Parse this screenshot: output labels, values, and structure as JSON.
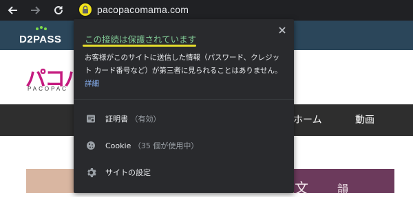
{
  "browser": {
    "url": "pacopacomama.com",
    "back_icon": "back-arrow-icon",
    "forward_icon": "forward-arrow-icon",
    "reload_icon": "reload-icon",
    "lock_icon": "lock-icon"
  },
  "site": {
    "d2pass_logo": "D2PASS",
    "paco_logo": "パコパ",
    "paco_sub": "PACOPAC",
    "nav_home": "ホーム",
    "nav_video": "動画",
    "banner_text1": "文",
    "banner_text2": "韻"
  },
  "popup": {
    "title": "この接続は保護されています",
    "description": "お客様がこのサイトに送信した情報（パスワード、クレジット カード番号など）が第三者に見られることはありません。",
    "details_link": "詳細",
    "close_icon": "close-icon",
    "rows": [
      {
        "icon": "certificate-icon",
        "label": "証明書",
        "sub": "（有効）"
      },
      {
        "icon": "cookie-icon",
        "label": "Cookie",
        "sub": "（35 個が使用中）"
      },
      {
        "icon": "gear-icon",
        "label": "サイトの設定",
        "sub": ""
      }
    ]
  },
  "colors": {
    "secure_green": "#81c995",
    "highlight_yellow": "#e6dd2c",
    "link_blue": "#8ab4f8",
    "popup_bg": "#292a2d"
  }
}
